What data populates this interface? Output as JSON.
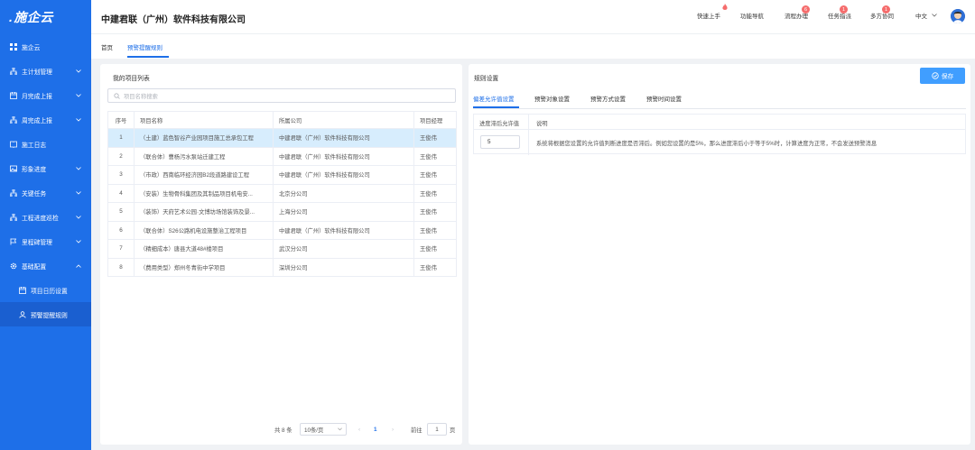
{
  "app": {
    "logo": "施企云",
    "company": "中建君联（广州）软件科技有限公司"
  },
  "sidebar": {
    "items": [
      {
        "label": "施企云",
        "icon": "grid-icon"
      },
      {
        "label": "主计划管理",
        "icon": "org-icon"
      },
      {
        "label": "月完成上报",
        "icon": "calendar-icon"
      },
      {
        "label": "周完成上报",
        "icon": "org-icon"
      },
      {
        "label": "施工日志",
        "icon": "book-icon"
      },
      {
        "label": "形象进度",
        "icon": "image-icon"
      },
      {
        "label": "关键任务",
        "icon": "org-icon"
      },
      {
        "label": "工程进度巡检",
        "icon": "org-icon"
      },
      {
        "label": "里程碑管理",
        "icon": "flag-icon"
      },
      {
        "label": "基础配置",
        "icon": "gear-icon"
      },
      {
        "label": "项目日历设置",
        "icon": "calendar-icon"
      },
      {
        "label": "预警提醒规则",
        "icon": "user-icon"
      }
    ]
  },
  "header": {
    "quick_start": "快速上手",
    "func_nav": "功能导航",
    "flow": "流程办理",
    "flow_badge": "6",
    "task": "任务指派",
    "task_badge": "1",
    "collab": "多方协同",
    "collab_badge": "1",
    "lang": "中文"
  },
  "tabs": {
    "home": "首页",
    "current": "预警提醒规则"
  },
  "left": {
    "title": "我的项目列表",
    "search_placeholder": "项目名称搜索",
    "columns": [
      "序号",
      "项目名称",
      "所属公司",
      "项目经理"
    ],
    "rows": [
      [
        "1",
        "（土建）蓝色智谷产业园项目施工总承包工程",
        "中建君联（广州）软件科技有限公司",
        "王俊伟"
      ],
      [
        "2",
        "（联合体）曹杨污水泵站迁建工程",
        "中建君联（广州）软件科技有限公司",
        "王俊伟"
      ],
      [
        "3",
        "（市政）西南临环经济园B2段道路建设工程",
        "中建君联（广州）软件科技有限公司",
        "王俊伟"
      ],
      [
        "4",
        "（安装）生物骨科集团及其制品项目机电安...",
        "北京分公司",
        "王俊伟"
      ],
      [
        "5",
        "（装饰）天府艺术公园·文博坊场馆装饰及景...",
        "上海分公司",
        "王俊伟"
      ],
      [
        "6",
        "（联合体）S26公路机电设施整治工程项目",
        "中建君联（广州）软件科技有限公司",
        "王俊伟"
      ],
      [
        "7",
        "（精细成本）唐县大道48#楼项目",
        "武汉分公司",
        "王俊伟"
      ],
      [
        "8",
        "（费用类型）郑州冬青街中学项目",
        "深圳分公司",
        "王俊伟"
      ]
    ],
    "pager": {
      "total": "共 8 条",
      "size": "10条/页",
      "page": "1",
      "goto": "前往",
      "goto_value": "1",
      "unit": "页"
    }
  },
  "right": {
    "title": "规则设置",
    "save": "保存",
    "tabs": [
      "偏差允许值设置",
      "预警对象设置",
      "预警方式设置",
      "预警时间设置"
    ],
    "col_value": "进度滞后允许值",
    "col_desc": "说明",
    "value": "5",
    "desc": "系统将根据您设置的允许值判断进度是否滞后。例如您设置的是5%，那么进度滞后小于等于5%时，计算进度为正常，不会发送预警消息"
  }
}
